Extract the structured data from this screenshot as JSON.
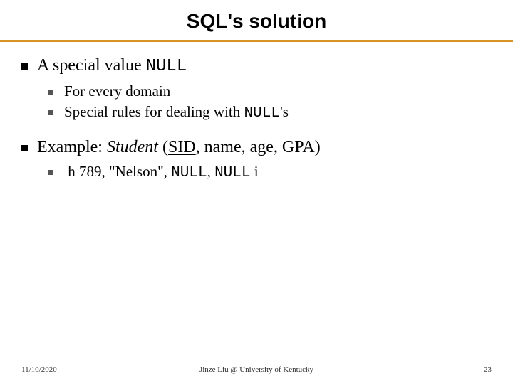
{
  "title": "SQL's solution",
  "bullets": {
    "b1": "A special value ",
    "b1_code": "NULL",
    "b1_1": "For every domain",
    "b1_2a": "Special rules for dealing with ",
    "b1_2code": "NULL",
    "b1_2b": "'s",
    "b2a": "Example: ",
    "b2_student": "Student",
    "b2_paren_open": " (",
    "b2_sid": "SID",
    "b2_rest": ", name, age, GPA)",
    "b2_1a": "h 789, \"Nelson\", ",
    "b2_1null1": "NULL",
    "b2_1comma": ", ",
    "b2_1null2": "NULL",
    "b2_1end": " i"
  },
  "footer": {
    "date": "11/10/2020",
    "center": "Jinze Liu @ University of Kentucky",
    "num": "23"
  }
}
